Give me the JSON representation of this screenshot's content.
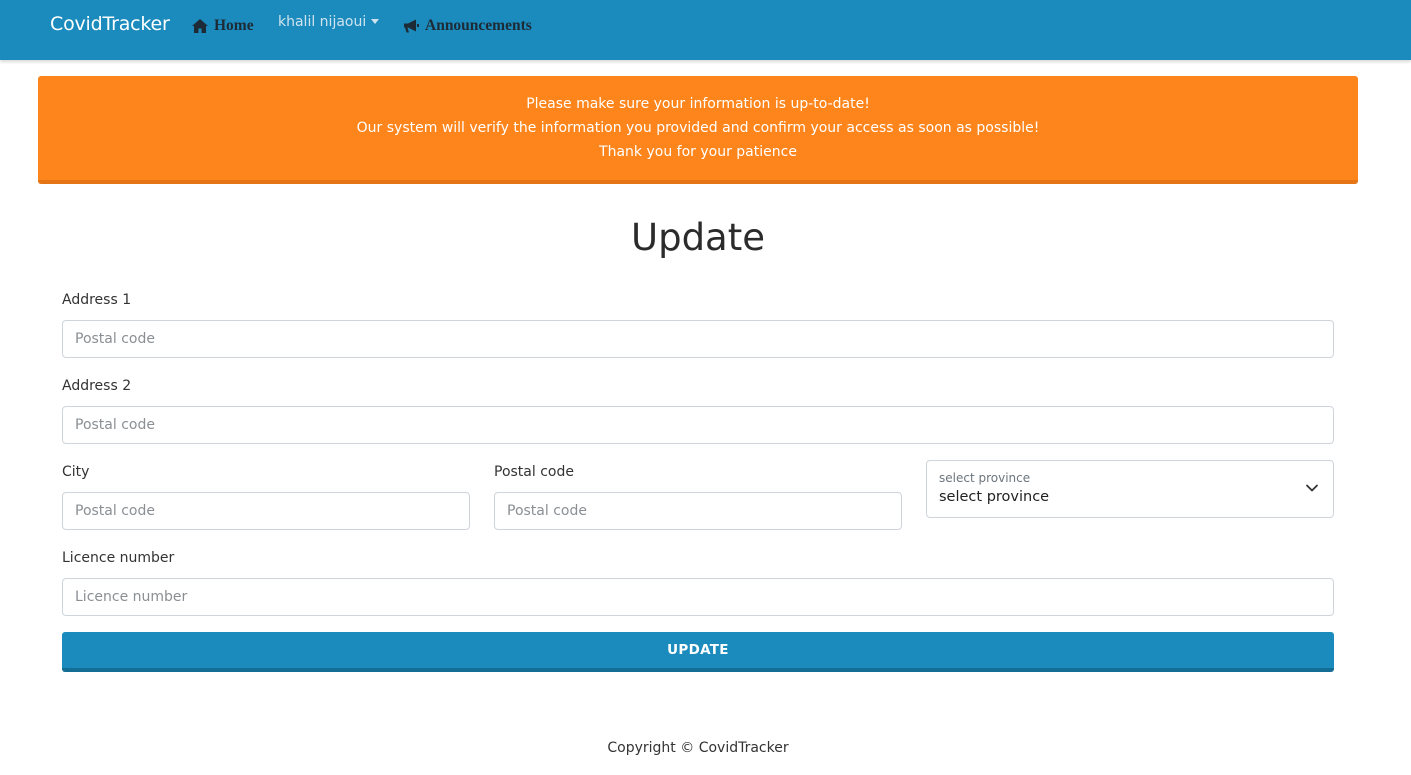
{
  "navbar": {
    "brand": "CovidTracker",
    "home_label": "Home",
    "user_label": "khalil nijaoui",
    "announcements_label": "Announcements",
    "bg_color": "#1b8bbd"
  },
  "alert": {
    "line1": "Please make sure your information is up-to-date!",
    "line2": "Our system will verify the information you provided and confirm your access as soon as possible!",
    "line3": "Thank you for your patience",
    "bg_color": "#fd851c"
  },
  "form": {
    "title": "Update",
    "address1": {
      "label": "Address 1",
      "placeholder": "Postal code",
      "value": ""
    },
    "address2": {
      "label": "Address 2",
      "placeholder": "Postal code",
      "value": ""
    },
    "city": {
      "label": "City",
      "placeholder": "Postal code",
      "value": ""
    },
    "postal_code": {
      "label": "Postal code",
      "placeholder": "Postal code",
      "value": ""
    },
    "province": {
      "floating_label": "select province",
      "selected": "select province"
    },
    "licence": {
      "label": "Licence number",
      "placeholder": "Licence number",
      "value": ""
    },
    "submit_label": "UPDATE"
  },
  "footer": {
    "text": "Copyright © CovidTracker"
  }
}
